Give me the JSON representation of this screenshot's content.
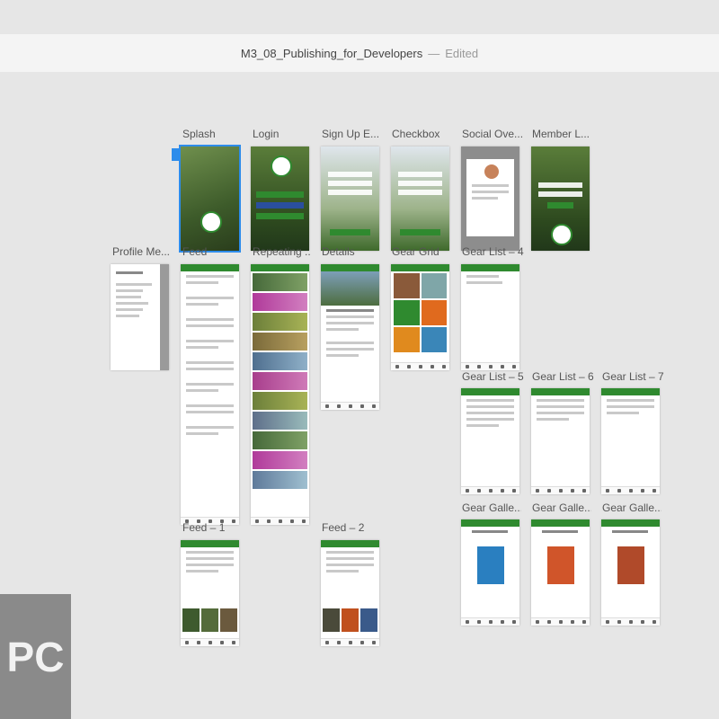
{
  "window": {
    "title": "M3_08_Publishing_for_Developers",
    "separator": "—",
    "status": "Edited"
  },
  "artboards": [
    {
      "label": "Splash"
    },
    {
      "label": "Login"
    },
    {
      "label": "Sign Up E..."
    },
    {
      "label": "Checkbox"
    },
    {
      "label": "Social Ove..."
    },
    {
      "label": "Member L..."
    },
    {
      "label": "Profile Me..."
    },
    {
      "label": "Feed"
    },
    {
      "label": "Repeating ..."
    },
    {
      "label": "Details"
    },
    {
      "label": "Gear Grid"
    },
    {
      "label": "Gear List – 4"
    },
    {
      "label": "Gear List – 5"
    },
    {
      "label": "Gear List – 6"
    },
    {
      "label": "Gear List – 7"
    },
    {
      "label": "Feed – 1"
    },
    {
      "label": "Feed – 2"
    },
    {
      "label": "Gear Galle..."
    },
    {
      "label": "Gear Galle..."
    },
    {
      "label": "Gear Galle..."
    }
  ],
  "watermark": {
    "text": "PC"
  },
  "colors": {
    "accent": "#2f8a2f",
    "selection": "#2d8ceb"
  }
}
